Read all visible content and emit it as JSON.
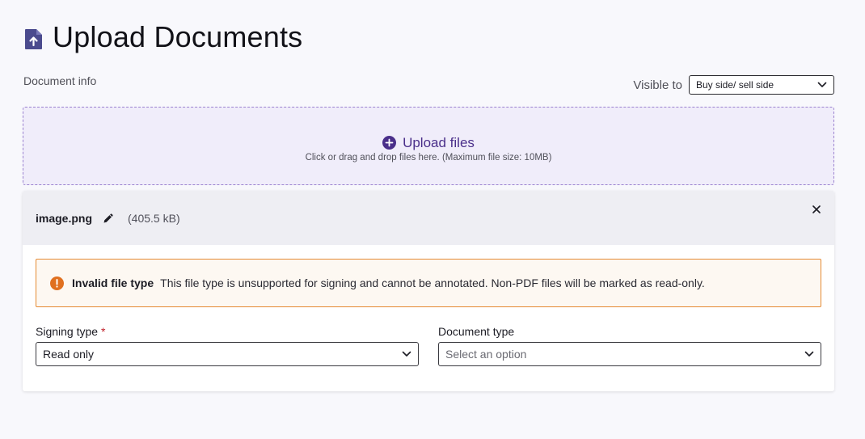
{
  "header": {
    "title": "Upload Documents",
    "icon": "file-upload-icon"
  },
  "document_info": {
    "label": "Document info"
  },
  "visible_to": {
    "label": "Visible to",
    "selected": "Buy side/ sell side"
  },
  "dropzone": {
    "title": "Upload files",
    "subtitle": "Click or drag and drop files here. (Maximum file size: 10MB)",
    "icon": "plus-circle-icon"
  },
  "file": {
    "name": "image.png",
    "size": "(405.5 kB)"
  },
  "alert": {
    "title": "Invalid file type",
    "message": "This file type is unsupported for signing and cannot be annotated. Non-PDF files will be marked as read-only.",
    "color": "#e58a32"
  },
  "signing_type": {
    "label": "Signing type",
    "required_marker": "*",
    "value": "Read only"
  },
  "document_type": {
    "label": "Document type",
    "placeholder": "Select an option"
  },
  "colors": {
    "accent": "#4a2f8a",
    "warning": "#e07020"
  }
}
